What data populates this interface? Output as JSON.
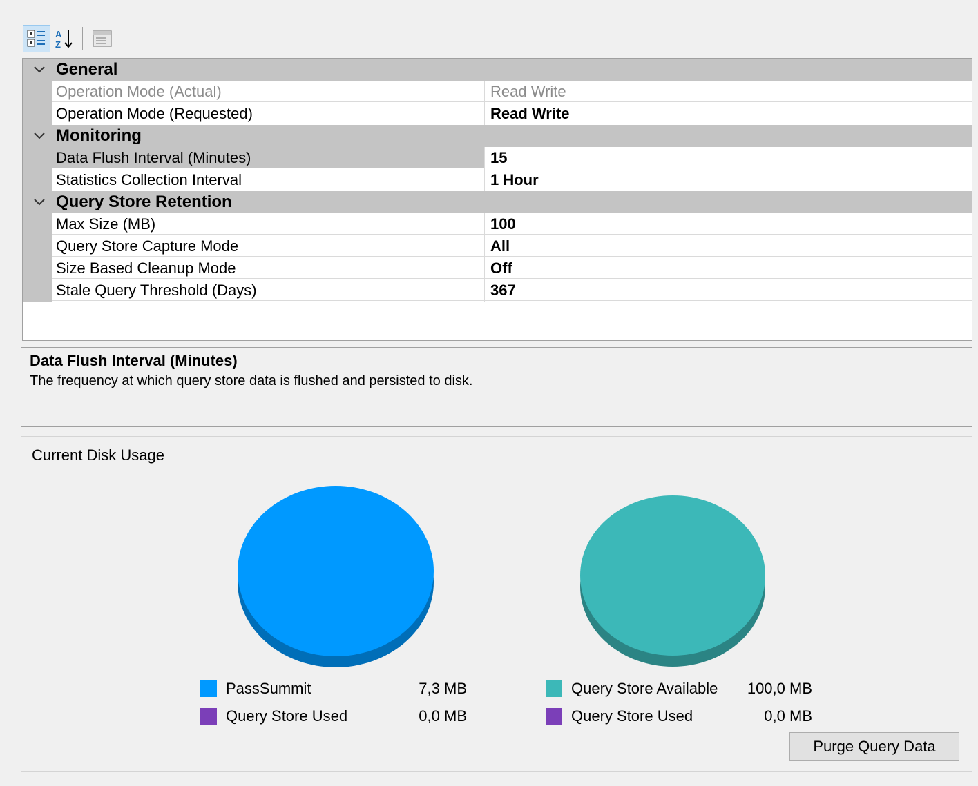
{
  "toolbar": {
    "categorized_icon": "categorized-icon",
    "alphabetical_icon": "alphabetical-sort-icon",
    "property_pages_icon": "property-pages-icon"
  },
  "property_grid": {
    "categories": [
      {
        "label": "General",
        "rows": [
          {
            "name": "Operation Mode (Actual)",
            "value": "Read Write",
            "state": "disabled"
          },
          {
            "name": "Operation Mode (Requested)",
            "value": "Read Write",
            "state": "bold"
          }
        ]
      },
      {
        "label": "Monitoring",
        "rows": [
          {
            "name": "Data Flush Interval (Minutes)",
            "value": "15",
            "state": "selected"
          },
          {
            "name": "Statistics Collection Interval",
            "value": "1 Hour",
            "state": "bold"
          }
        ]
      },
      {
        "label": "Query Store Retention",
        "rows": [
          {
            "name": "Max Size (MB)",
            "value": "100",
            "state": "bold"
          },
          {
            "name": "Query Store Capture Mode",
            "value": "All",
            "state": "bold"
          },
          {
            "name": "Size Based Cleanup Mode",
            "value": "Off",
            "state": "bold"
          },
          {
            "name": "Stale Query Threshold (Days)",
            "value": "367",
            "state": "bold"
          }
        ]
      }
    ]
  },
  "description": {
    "title": "Data Flush Interval (Minutes)",
    "text": "The frequency at which query store data is flushed and persisted to disk."
  },
  "disk_usage": {
    "title": "Current Disk Usage",
    "charts": [
      {
        "legend": [
          {
            "label": "PassSummit",
            "value": "7,3 MB",
            "color": "#0099ff"
          },
          {
            "label": "Query Store Used",
            "value": "0,0 MB",
            "color": "#7b3fb8"
          }
        ]
      },
      {
        "legend": [
          {
            "label": "Query Store Available",
            "value": "100,0 MB",
            "color": "#3cb8b8"
          },
          {
            "label": "Query Store Used",
            "value": "0,0 MB",
            "color": "#7b3fb8"
          }
        ]
      }
    ],
    "purge_button_label": "Purge Query Data"
  },
  "chart_data": [
    {
      "type": "pie",
      "categories": [
        "PassSummit",
        "Query Store Used"
      ],
      "values": [
        7.3,
        0.0
      ],
      "colors": [
        "#0099ff",
        "#7b3fb8"
      ],
      "value_labels": [
        "7,3 MB",
        "0,0 MB"
      ]
    },
    {
      "type": "pie",
      "categories": [
        "Query Store Available",
        "Query Store Used"
      ],
      "values": [
        100.0,
        0.0
      ],
      "colors": [
        "#3cb8b8",
        "#7b3fb8"
      ],
      "value_labels": [
        "100,0 MB",
        "0,0 MB"
      ]
    }
  ]
}
